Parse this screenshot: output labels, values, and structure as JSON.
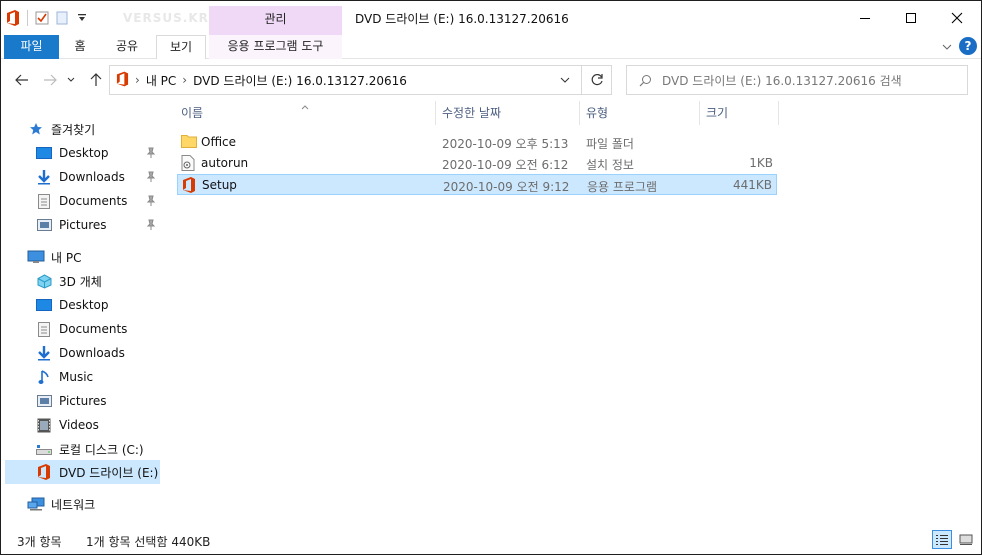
{
  "window": {
    "title": "DVD 드라이브 (E:) 16.0.13127.20616",
    "manage_tab": "관리",
    "watermark": "VERSUS.KR"
  },
  "ribbon": {
    "tabs": [
      {
        "label": "파일"
      },
      {
        "label": "홈"
      },
      {
        "label": "공유"
      },
      {
        "label": "보기"
      },
      {
        "label": "응용 프로그램 도구"
      }
    ]
  },
  "address": {
    "crumbs": [
      "내 PC",
      "DVD 드라이브 (E:) 16.0.13127.20616"
    ],
    "search_placeholder": "DVD 드라이브 (E:) 16.0.13127.20616 검색"
  },
  "nav": {
    "quick_access": "즐겨찾기",
    "quick_items": [
      "Desktop",
      "Downloads",
      "Documents",
      "Pictures"
    ],
    "this_pc": "내 PC",
    "pc_items": [
      "3D 개체",
      "Desktop",
      "Documents",
      "Downloads",
      "Music",
      "Pictures",
      "Videos",
      "로컬 디스크 (C:)",
      "DVD 드라이브 (E:)"
    ],
    "network": "네트워크"
  },
  "columns": {
    "name": "이름",
    "date": "수정한 날짜",
    "type": "유형",
    "size": "크기"
  },
  "files": [
    {
      "name": "Office",
      "date": "2020-10-09 오후 5:13",
      "type": "파일 폴더",
      "size": ""
    },
    {
      "name": "autorun",
      "date": "2020-10-09 오전 6:12",
      "type": "설치 정보",
      "size": "1KB"
    },
    {
      "name": "Setup",
      "date": "2020-10-09 오전 9:12",
      "type": "응용 프로그램",
      "size": "441KB"
    }
  ],
  "status": {
    "count": "3개 항목",
    "selected": "1개 항목 선택함 440KB"
  },
  "colors": {
    "file_tab": "#1979ca",
    "manage_tab": "#f0d9f7",
    "selection": "#cce8ff",
    "office_red": "#d83b01"
  }
}
